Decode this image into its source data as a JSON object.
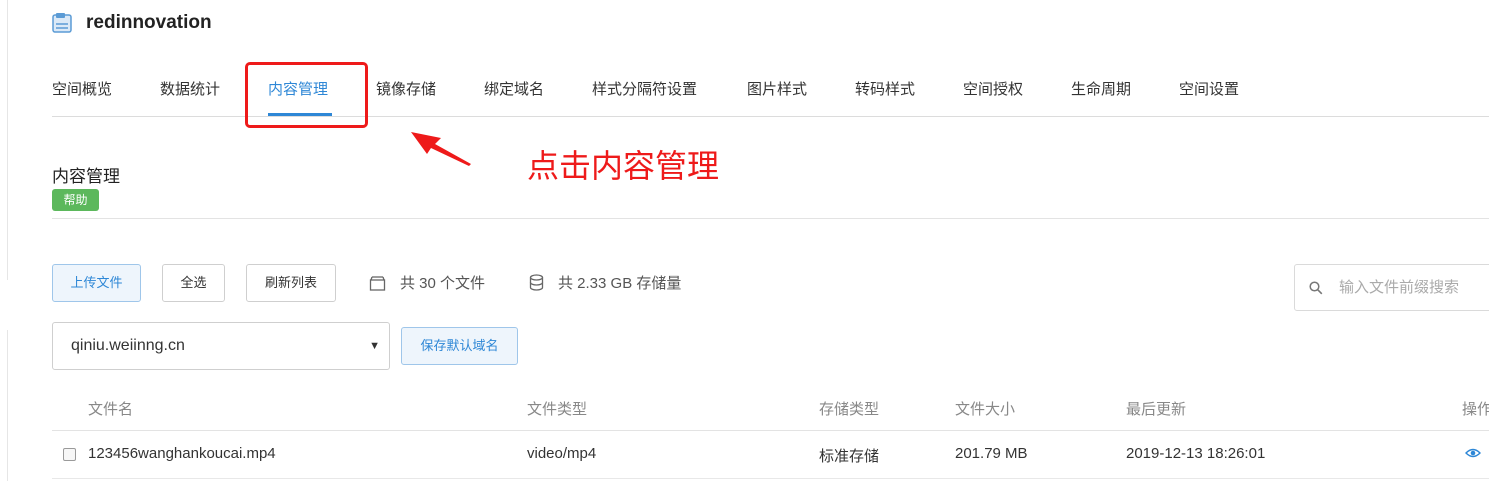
{
  "header": {
    "bucket_name": "redinnovation",
    "icon": "bucket-icon"
  },
  "tabs": [
    {
      "label": "空间概览"
    },
    {
      "label": "数据统计"
    },
    {
      "label": "内容管理",
      "active": true
    },
    {
      "label": "镜像存储"
    },
    {
      "label": "绑定域名"
    },
    {
      "label": "样式分隔符设置"
    },
    {
      "label": "图片样式"
    },
    {
      "label": "转码样式"
    },
    {
      "label": "空间授权"
    },
    {
      "label": "生命周期"
    },
    {
      "label": "空间设置"
    }
  ],
  "annotation": {
    "text": "点击内容管理",
    "color": "#ee1a1a"
  },
  "section": {
    "title": "内容管理",
    "help_label": "帮助"
  },
  "toolbar": {
    "upload_label": "上传文件",
    "select_all_label": "全选",
    "refresh_label": "刷新列表",
    "file_count_text": "共 30 个文件",
    "storage_text": "共 2.33 GB 存储量",
    "search_placeholder": "输入文件前缀搜索"
  },
  "domain": {
    "selected": "qiniu.weiinng.cn",
    "save_label": "保存默认域名"
  },
  "table": {
    "headers": [
      "文件名",
      "文件类型",
      "存储类型",
      "文件大小",
      "最后更新",
      "操作"
    ],
    "rows": [
      {
        "name": "123456wanghankoucai.mp4",
        "type": "video/mp4",
        "storage": "标准存储",
        "size": "201.79 MB",
        "updated": "2019-12-13 18:26:01",
        "action_icon": "eye-icon"
      }
    ]
  },
  "colors": {
    "accent": "#2e87d6",
    "help_badge": "#5cb85c",
    "annotation": "#ee1a1a"
  }
}
